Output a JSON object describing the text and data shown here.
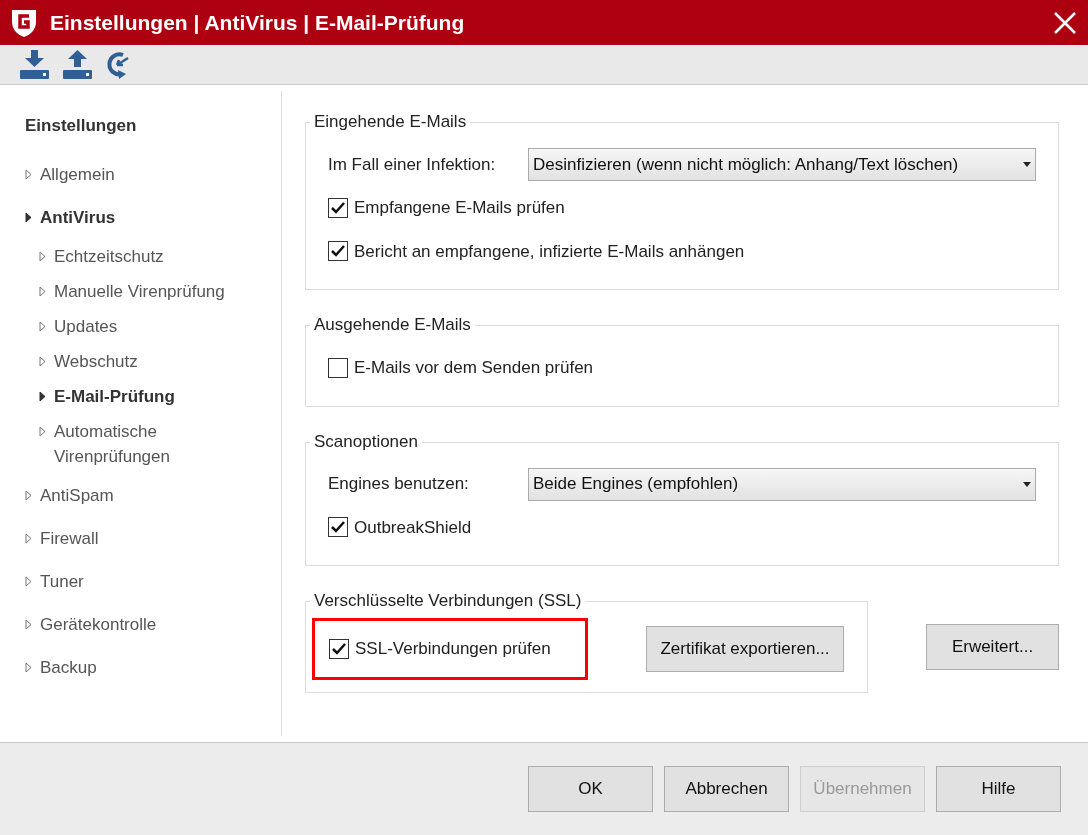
{
  "window": {
    "title": "Einstellungen | AntiVirus | E-Mail-Prüfung"
  },
  "sidebar": {
    "heading": "Einstellungen",
    "items": [
      {
        "label": "Allgemein",
        "selected": false
      },
      {
        "label": "AntiVirus",
        "selected": true,
        "children": [
          {
            "label": "Echtzeitschutz",
            "selected": false
          },
          {
            "label": "Manuelle Virenprüfung",
            "selected": false
          },
          {
            "label": "Updates",
            "selected": false
          },
          {
            "label": "Webschutz",
            "selected": false
          },
          {
            "label": "E-Mail-Prüfung",
            "selected": true
          },
          {
            "label": "Automatische Virenprüfungen",
            "selected": false
          }
        ]
      },
      {
        "label": "AntiSpam",
        "selected": false
      },
      {
        "label": "Firewall",
        "selected": false
      },
      {
        "label": "Tuner",
        "selected": false
      },
      {
        "label": "Gerätekontrolle",
        "selected": false
      },
      {
        "label": "Backup",
        "selected": false
      }
    ]
  },
  "sections": [
    {
      "title": "Eingehende E-Mails",
      "rows": [
        {
          "kind": "dropdown",
          "label": "Im Fall einer Infektion:",
          "value": "Desinfizieren (wenn nicht möglich: Anhang/Text löschen)"
        },
        {
          "kind": "checkbox",
          "label": "Empfangene E-Mails prüfen",
          "checked": true
        },
        {
          "kind": "checkbox",
          "label": "Bericht an empfangene, infizierte E-Mails anhängen",
          "checked": true
        }
      ]
    },
    {
      "title": "Ausgehende E-Mails",
      "rows": [
        {
          "kind": "checkbox",
          "label": "E-Mails vor dem Senden prüfen",
          "checked": false
        }
      ]
    },
    {
      "title": "Scanoptionen",
      "rows": [
        {
          "kind": "dropdown",
          "label": "Engines benutzen:",
          "value": "Beide Engines (empfohlen)"
        },
        {
          "kind": "checkbox",
          "label": "OutbreakShield",
          "checked": true
        }
      ]
    }
  ],
  "ssl": {
    "title": "Verschlüsselte Verbindungen (SSL)",
    "checkbox": {
      "label": "SSL-Verbindungen prüfen",
      "checked": true,
      "highlighted": true
    },
    "export_button": "Zertifikat exportieren...",
    "advanced_button": "Erweitert..."
  },
  "footer_buttons": [
    {
      "label": "OK",
      "disabled": false
    },
    {
      "label": "Abbrechen",
      "disabled": false
    },
    {
      "label": "Übernehmen",
      "disabled": true
    },
    {
      "label": "Hilfe",
      "disabled": false
    }
  ]
}
